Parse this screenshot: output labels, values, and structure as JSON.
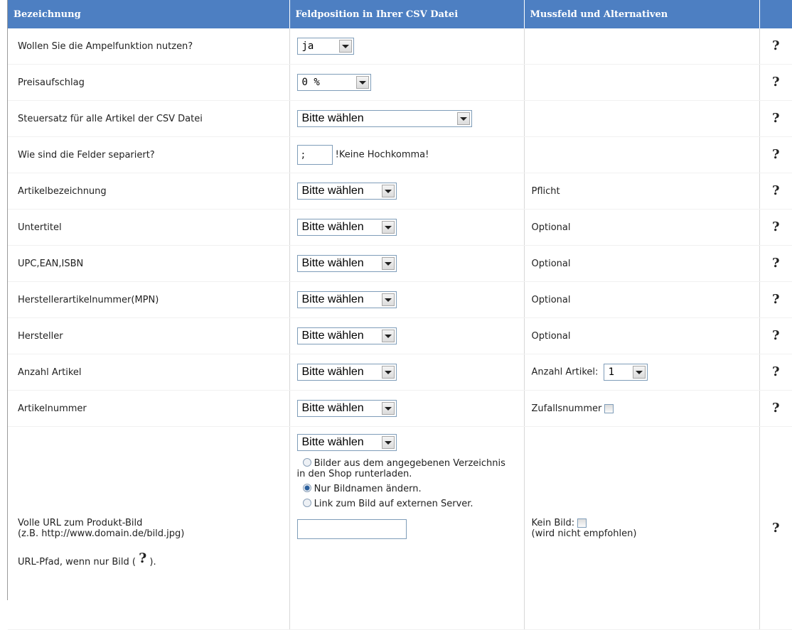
{
  "header": {
    "col1": "Bezeichnung",
    "col2": "Feldposition in Ihrer CSV Datei",
    "col3": "Mussfeld und Alternativen",
    "col4": ""
  },
  "rows": [
    {
      "label": "Wollen Sie die Ampelfunktion nutzen?",
      "select": "ja",
      "note": ""
    },
    {
      "label": "Preisaufschlag",
      "select": "0 %",
      "note": ""
    },
    {
      "label": "Steuersatz für alle Artikel der CSV Datei",
      "select": "Bitte wählen",
      "note": ""
    },
    {
      "label": "Wie sind die Felder separiert?",
      "input": ";",
      "input_hint": "!Keine Hochkomma!",
      "note": ""
    },
    {
      "label": "Artikelbezeichnung",
      "select": "Bitte wählen",
      "note": "Pflicht"
    },
    {
      "label": "Untertitel",
      "select": "Bitte wählen",
      "note": "Optional"
    },
    {
      "label": "UPC,EAN,ISBN",
      "select": "Bitte wählen",
      "note": "Optional"
    },
    {
      "label": "Herstellerartikelnummer(MPN)",
      "select": "Bitte wählen",
      "note": "Optional"
    },
    {
      "label": "Hersteller",
      "select": "Bitte wählen",
      "note": "Optional"
    },
    {
      "label": "Anzahl Artikel",
      "select": "Bitte wählen",
      "note": "Anzahl Artikel:",
      "note_select": "1"
    },
    {
      "label": "Artikelnummer",
      "select": "Bitte wählen",
      "note": "Zufallsnummer"
    },
    {
      "label_line1": "Volle URL zum Produkt-Bild",
      "label_line2": "(z.B. http://www.domain.de/bild.jpg)",
      "label_line3_pre": "URL-Pfad, wenn nur Bild (",
      "label_line3_post": ").",
      "select": "Bitte wählen",
      "radio_options": [
        {
          "label": "Bilder aus dem angegebenen Verzeichnis in den Shop runterladen.",
          "selected": false
        },
        {
          "label": "Nur Bildnamen ändern.",
          "selected": true
        },
        {
          "label": "Link zum Bild auf externen Server.",
          "selected": false
        }
      ],
      "url_input": "",
      "note": "Kein Bild:",
      "note_sub": "(wird nicht empfohlen)"
    }
  ],
  "help_icon_glyph": "?"
}
